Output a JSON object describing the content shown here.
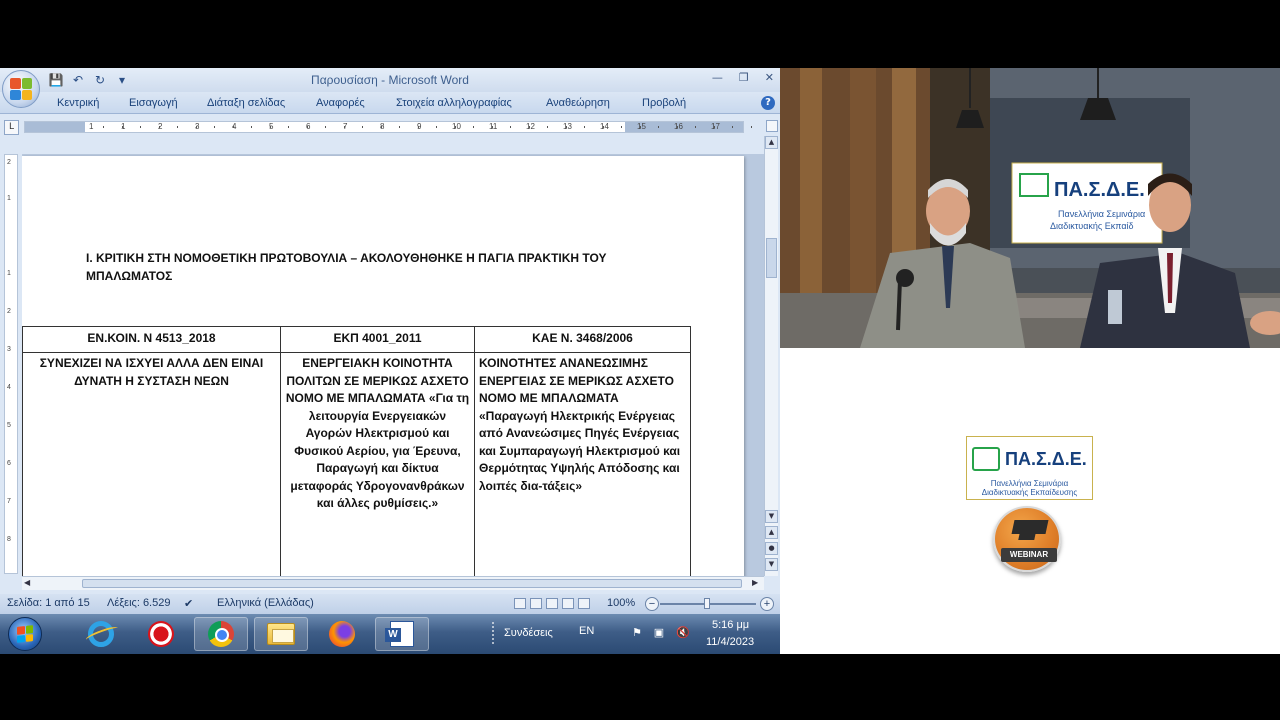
{
  "word": {
    "window_title": "Παρουσίαση - Microsoft Word",
    "tabs": [
      "Κεντρική",
      "Εισαγωγή",
      "Διάταξη σελίδας",
      "Αναφορές",
      "Στοιχεία αλληλογραφίας",
      "Αναθεώρηση",
      "Προβολή"
    ],
    "ruler_numbers": [
      "1",
      "1",
      "2",
      "3",
      "4",
      "5",
      "6",
      "7",
      "8",
      "9",
      "10",
      "11",
      "12",
      "13",
      "14",
      "15",
      "16",
      "17"
    ],
    "vruler_numbers": [
      "2",
      "1",
      "1",
      "2",
      "3",
      "4",
      "5",
      "6",
      "7",
      "8"
    ],
    "document": {
      "heading": "Ι. ΚΡΙΤΙΚΗ ΣΤΗ ΝΟΜΟΘΕΤΙΚΗ ΠΡΩΤΟΒΟΥΛΙΑ – ΑΚΟΛΟΥΘΗΘΗΚΕ Η ΠΑΓΙΑ ΠΡΑΚΤΙΚΗ ΤΟΥ ΜΠΑΛΩΜΑΤΟΣ",
      "table": {
        "headers": [
          "ΕΝ.ΚΟΙΝ. Ν 4513_2018",
          "ΕΚΠ 4001_2011",
          "ΚΑΕ Ν. 3468/2006"
        ],
        "cells": [
          "ΣΥΝΕΧΙΖΕΙ ΝΑ ΙΣΧΥΕΙ ΑΛΛΑ ΔΕΝ ΕΙΝΑΙ ΔΥΝΑΤΗ Η ΣΥΣΤΑΣΗ ΝΕΩΝ",
          "ΕΝΕΡΓΕΙΑΚΗ ΚΟΙΝΟΤΗΤΑ ΠΟΛΙΤΩΝ ΣΕ ΜΕΡΙΚΩΣ ΑΣΧΕΤΟ ΝΟΜΟ ΜΕ ΜΠΑΛΩΜΑΤΑ «Για τη λειτουργία Ενεργειακών Αγορών Ηλεκτρισμού και Φυσικού Αερίου, για Έρευνα, Παραγωγή και δίκτυα μεταφοράς Υδρογονανθράκων και άλλες ρυθμίσεις.»",
          "ΚΟΙΝΟΤΗΤΕΣ ΑΝΑΝΕΩΣΙΜΗΣ ΕΝΕΡΓΕΙΑΣ ΣΕ ΜΕΡΙΚΩΣ ΑΣΧΕΤΟ ΝΟΜΟ ΜΕ ΜΠΑΛΩΜΑΤΑ «Παραγωγή Ηλεκτρικής Ενέργειας από Ανανεώσιμες Πηγές Ενέργειας και Συμπαραγωγή Ηλεκτρισμού και Θερμότητας Υψηλής Απόδοσης και λοιπές δια-τάξεις»"
        ]
      }
    },
    "status": {
      "page": "Σελίδα: 1 από 15",
      "words": "Λέξεις: 6.529",
      "language": "Ελληνικά (Ελλάδας)",
      "zoom": "100%",
      "zoom_minus": "−",
      "zoom_plus": "+"
    }
  },
  "taskbar": {
    "connections": "Συνδέσεις",
    "lang": "EN",
    "time": "5:16 μμ",
    "date": "11/4/2023",
    "apps": [
      "internet-explorer",
      "recorder",
      "chrome",
      "file-explorer",
      "firefox",
      "microsoft-word"
    ]
  },
  "branding": {
    "logo_text": "ΠΑ.Σ.Δ.Ε.",
    "logo_sub1": "Πανελλήνια Σεμινάρια",
    "logo_sub2": "Διαδικτυακής Εκπαίδευσης",
    "video_logo_sub2": "Διαδικτυακής Εκπαίδ",
    "webinar": "WEBINAR"
  },
  "colors": {
    "brand_blue": "#16407d",
    "brand_green": "#27a34a",
    "word_chrome": "#dce7f5"
  }
}
